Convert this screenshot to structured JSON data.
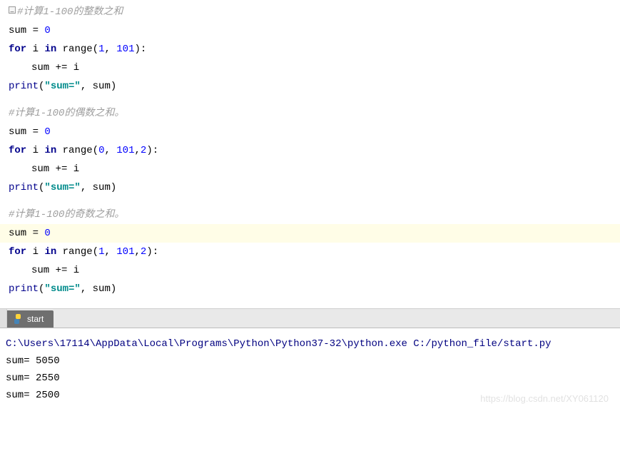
{
  "code": {
    "block1": {
      "comment": "#计算1-100的整数之和",
      "l1_a": "sum = ",
      "l1_b": "0",
      "l2_a": "for",
      "l2_b": " i ",
      "l2_c": "in",
      "l2_d": " range(",
      "l2_e": "1",
      "l2_f": ", ",
      "l2_g": "101",
      "l2_h": "):",
      "l3": "sum += i",
      "l4_a": "print",
      "l4_b": "(",
      "l4_c": "\"sum=\"",
      "l4_d": ", sum)"
    },
    "block2": {
      "comment": "#计算1-100的偶数之和。",
      "l1_a": "sum = ",
      "l1_b": "0",
      "l2_a": "for",
      "l2_b": " i ",
      "l2_c": "in",
      "l2_d": " range(",
      "l2_e": "0",
      "l2_f": ", ",
      "l2_g": "101",
      "l2_h": ",",
      "l2_i": "2",
      "l2_j": "):",
      "l3": "sum += i",
      "l4_a": "print",
      "l4_b": "(",
      "l4_c": "\"sum=\"",
      "l4_d": ", sum)"
    },
    "block3": {
      "comment": "#计算1-100的奇数之和。",
      "l1_a": "sum = ",
      "l1_b": "0",
      "l2_a": "for",
      "l2_b": " i ",
      "l2_c": "in",
      "l2_d": " range(",
      "l2_e": "1",
      "l2_f": ", ",
      "l2_g": "101",
      "l2_h": ",",
      "l2_i": "2",
      "l2_j": "):",
      "l3": "sum += i",
      "l4_a": "print",
      "l4_b": "(",
      "l4_c": "\"sum=\"",
      "l4_d": ", sum)"
    }
  },
  "tab": {
    "label": "start"
  },
  "console": {
    "path": "C:\\Users\\17114\\AppData\\Local\\Programs\\Python\\Python37-32\\python.exe C:/python_file/start.py",
    "out1": "sum= 5050",
    "out2": "sum= 2550",
    "out3": "sum= 2500"
  },
  "watermark": "https://blog.csdn.net/XY061120"
}
